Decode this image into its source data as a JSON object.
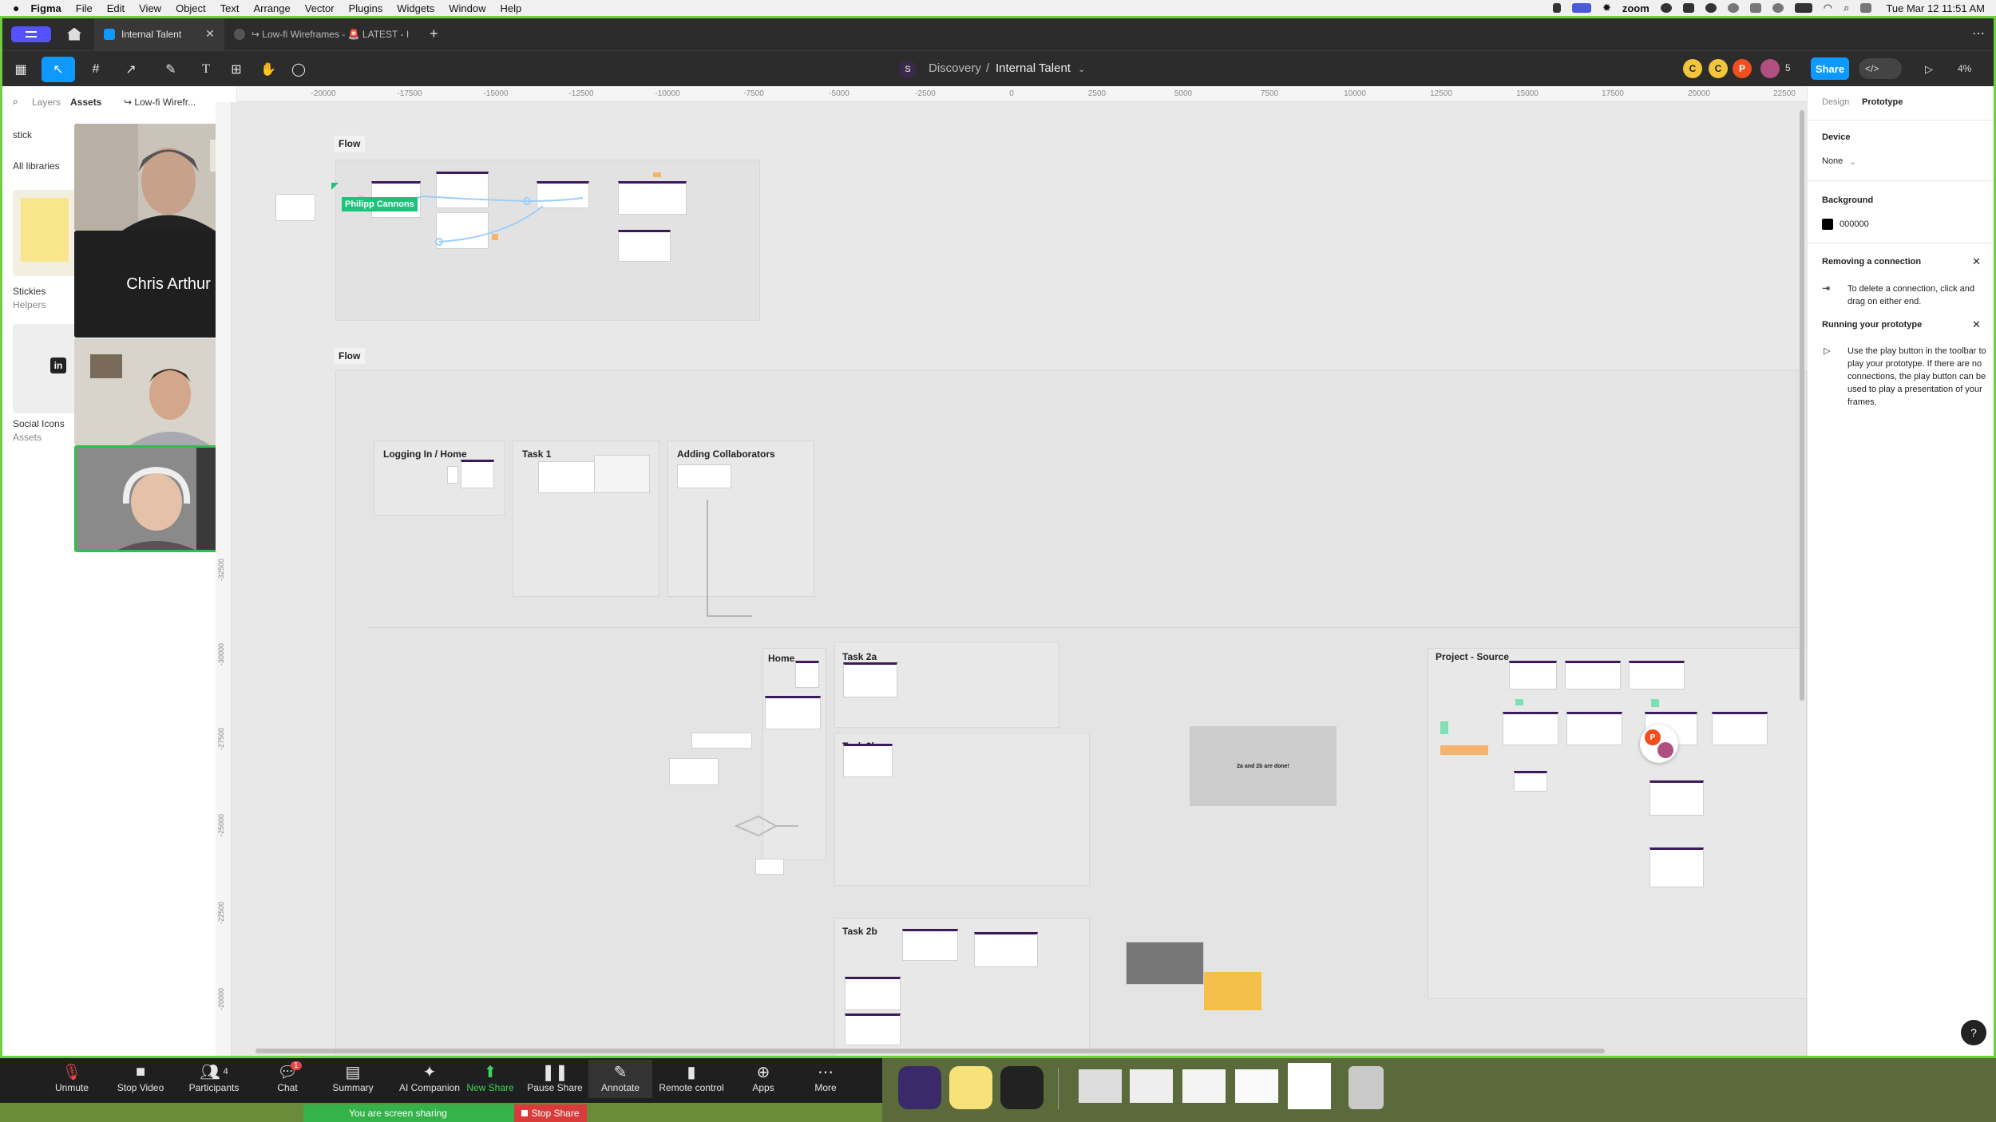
{
  "menubar": {
    "app": "Figma",
    "items": [
      "File",
      "Edit",
      "View",
      "Object",
      "Text",
      "Arrange",
      "Vector",
      "Plugins",
      "Widgets",
      "Window",
      "Help"
    ],
    "zoom_label": "zoom",
    "datetime": "Tue Mar 12  11:51 AM"
  },
  "tabs": [
    {
      "label": "Internal Talent",
      "active": true
    },
    {
      "label": "↪ Low-fi Wireframes - 🚨 LATEST - I",
      "active": false
    }
  ],
  "toolbar": {
    "project": "Discovery",
    "separator": "/",
    "file": "Internal Talent",
    "avatars": [
      "C",
      "C",
      "P"
    ],
    "viewer_count": "5",
    "share": "Share",
    "zoom": "4%"
  },
  "left_panel": {
    "tabs": [
      "Layers",
      "Assets",
      "↪ Low-fi Wirefr..."
    ],
    "search_value": "stick",
    "libraries": "All libraries",
    "items": [
      {
        "name": "Stickies",
        "sub": "Helpers"
      },
      {
        "name": "Social Icons",
        "sub": "Assets"
      }
    ]
  },
  "participants": [
    {
      "name": "Chris Arthur"
    }
  ],
  "canvas": {
    "cursor_name": "Philipp Cannons",
    "ruler_top": [
      "-20000",
      "-17500",
      "-15000",
      "-12500",
      "-10000",
      "-7500",
      "-5000",
      "-2500",
      "0",
      "2500",
      "5000",
      "7500",
      "10000",
      "12500",
      "15000",
      "17500",
      "20000",
      "22500"
    ],
    "ruler_left": [
      "-32500",
      "-30000",
      "-27500",
      "-25000",
      "-22500",
      "-20000"
    ],
    "sections": [
      "Flow",
      "Flow",
      "Logging In / Home",
      "Task 1",
      "Adding Collaborators",
      "Home",
      "Task 2a",
      "Task 2b",
      "Task 2b",
      "Project - Source"
    ],
    "callout": "2a and 2b are done!"
  },
  "right_panel": {
    "tabs": [
      "Design",
      "Prototype"
    ],
    "device_label": "Device",
    "device_value": "None",
    "background_label": "Background",
    "background_value": "000000",
    "tips": [
      {
        "title": "Removing a connection",
        "body": "To delete a connection, click and drag on either end."
      },
      {
        "title": "Running your prototype",
        "body": "Use the play button in the toolbar to play your prototype. If there are no connections, the play button can be used to play a presentation of your frames."
      }
    ],
    "help": "?"
  },
  "zoom_bar": {
    "buttons": [
      "Unmute",
      "Stop Video",
      "Participants",
      "Chat",
      "Summary",
      "AI Companion",
      "New Share",
      "Pause Share",
      "Annotate",
      "Remote control",
      "Apps",
      "More"
    ],
    "participants_count": "4",
    "chat_badge": "1",
    "sharing_text": "You are screen sharing",
    "stop_share": "Stop Share"
  },
  "colors": {
    "accent": "#0d99ff",
    "share_green": "#6fcf3f",
    "figma_dark": "#2c2c2c"
  }
}
